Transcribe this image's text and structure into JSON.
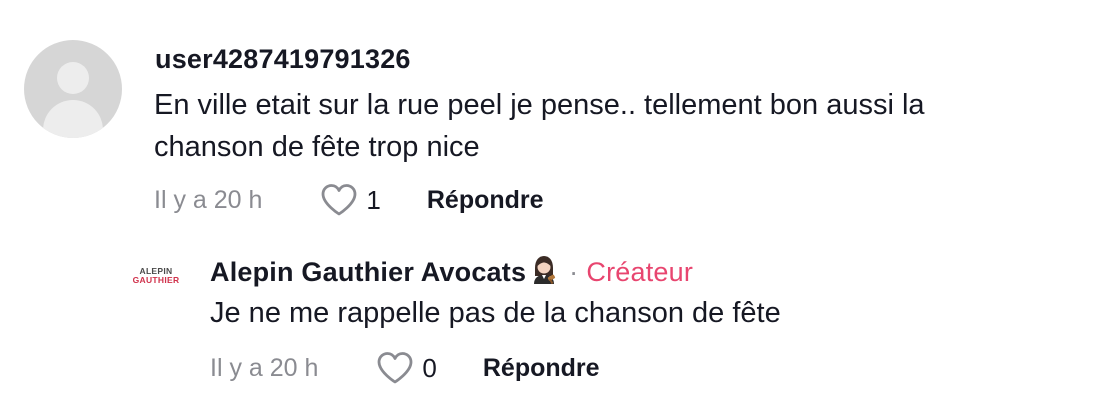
{
  "comment": {
    "username": "user4287419791326",
    "text_lines": [
      "En ville etait sur la rue peel je pense.. tellement bon aussi la",
      "chanson de fête trop nice"
    ],
    "time": "Il y a 20 h",
    "like_count": "1",
    "reply_label": "Répondre"
  },
  "reply": {
    "author": "Alepin Gauthier Avocats",
    "author_emoji": "woman-judge-emoji",
    "separator": "·",
    "creator_label": "Créateur",
    "avatar_logo": {
      "line1": "ALEPIN",
      "line2": "GAUTHIER"
    },
    "text": "Je ne me rappelle pas de la chanson de fête",
    "time": "Il y a 20 h",
    "like_count": "0",
    "reply_label": "Répondre"
  },
  "colors": {
    "text": "#161823",
    "muted": "#8a8b91",
    "creator": "#e8456f",
    "avatar_bg": "#d6d6d6"
  }
}
